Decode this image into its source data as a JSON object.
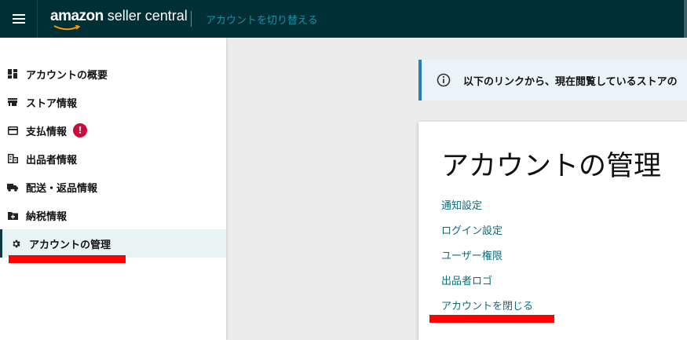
{
  "header": {
    "logo_amazon": "amazon",
    "logo_rest": " seller central",
    "switch_account": "アカウントを切り替える"
  },
  "sidebar": {
    "items": [
      {
        "label": "アカウントの概要",
        "icon": "dashboard-icon"
      },
      {
        "label": "ストア情報",
        "icon": "store-icon"
      },
      {
        "label": "支払情報",
        "icon": "credit-card-icon",
        "alert": "!"
      },
      {
        "label": "出品者情報",
        "icon": "building-icon"
      },
      {
        "label": "配送・返品情報",
        "icon": "truck-icon"
      },
      {
        "label": "納税情報",
        "icon": "folder-plus-icon"
      },
      {
        "label": "アカウントの管理",
        "icon": "gear-icon",
        "active": true
      }
    ]
  },
  "info_banner": {
    "icon": "info-icon",
    "text": "以下のリンクから、現在閲覧しているストアの"
  },
  "manage_card": {
    "title": "アカウントの管理",
    "links": [
      "通知設定",
      "ログイン設定",
      "ユーザー権限",
      "出品者ロゴ",
      "アカウントを閉じる"
    ]
  },
  "colors": {
    "topbar": "#002f36",
    "link": "#0e6b7a",
    "alert": "#cc0c39",
    "annotation": "#ff0000"
  }
}
